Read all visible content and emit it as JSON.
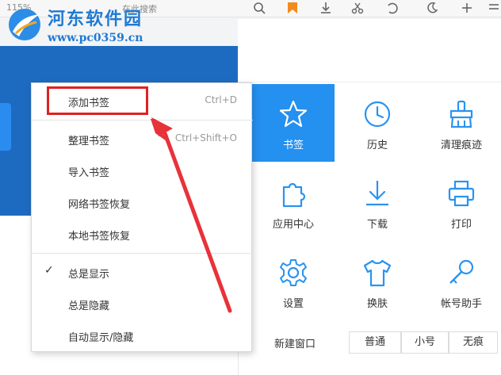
{
  "watermark": {
    "title": "河东软件园",
    "url": "www.pc0359.cn"
  },
  "toolbar": {
    "zoom": "115%",
    "search_placeholder": "在此搜索"
  },
  "context_menu": {
    "items": [
      {
        "label": "添加书签",
        "shortcut": "Ctrl+D",
        "checked": false
      },
      {
        "label": "整理书签",
        "shortcut": "Ctrl+Shift+O",
        "checked": false
      },
      {
        "label": "导入书签",
        "shortcut": "",
        "checked": false
      },
      {
        "label": "网络书签恢复",
        "shortcut": "",
        "checked": false
      },
      {
        "label": "本地书签恢复",
        "shortcut": "",
        "checked": false
      },
      {
        "label": "总是显示",
        "shortcut": "",
        "checked": true
      },
      {
        "label": "总是隐藏",
        "shortcut": "",
        "checked": false
      },
      {
        "label": "自动显示/隐藏",
        "shortcut": "",
        "checked": false
      }
    ],
    "check_glyph": "✓"
  },
  "panel": {
    "tiles": [
      {
        "label": "书签",
        "icon": "star-icon",
        "active": true
      },
      {
        "label": "历史",
        "icon": "clock-icon",
        "active": false
      },
      {
        "label": "清理痕迹",
        "icon": "broom-icon",
        "active": false
      },
      {
        "label": "应用中心",
        "icon": "puzzle-icon",
        "active": false
      },
      {
        "label": "下载",
        "icon": "download-icon",
        "active": false
      },
      {
        "label": "打印",
        "icon": "printer-icon",
        "active": false
      },
      {
        "label": "设置",
        "icon": "gear-icon",
        "active": false
      },
      {
        "label": "换肤",
        "icon": "tshirt-icon",
        "active": false
      },
      {
        "label": "帐号助手",
        "icon": "key-icon",
        "active": false
      }
    ],
    "new_window": {
      "label": "新建窗口",
      "options": [
        "普通",
        "小号",
        "无痕"
      ]
    }
  },
  "colors": {
    "accent": "#2490f0",
    "icon_blue": "#2a93f0",
    "highlight_red": "#e02020",
    "page_blue": "#1d6bc0"
  }
}
